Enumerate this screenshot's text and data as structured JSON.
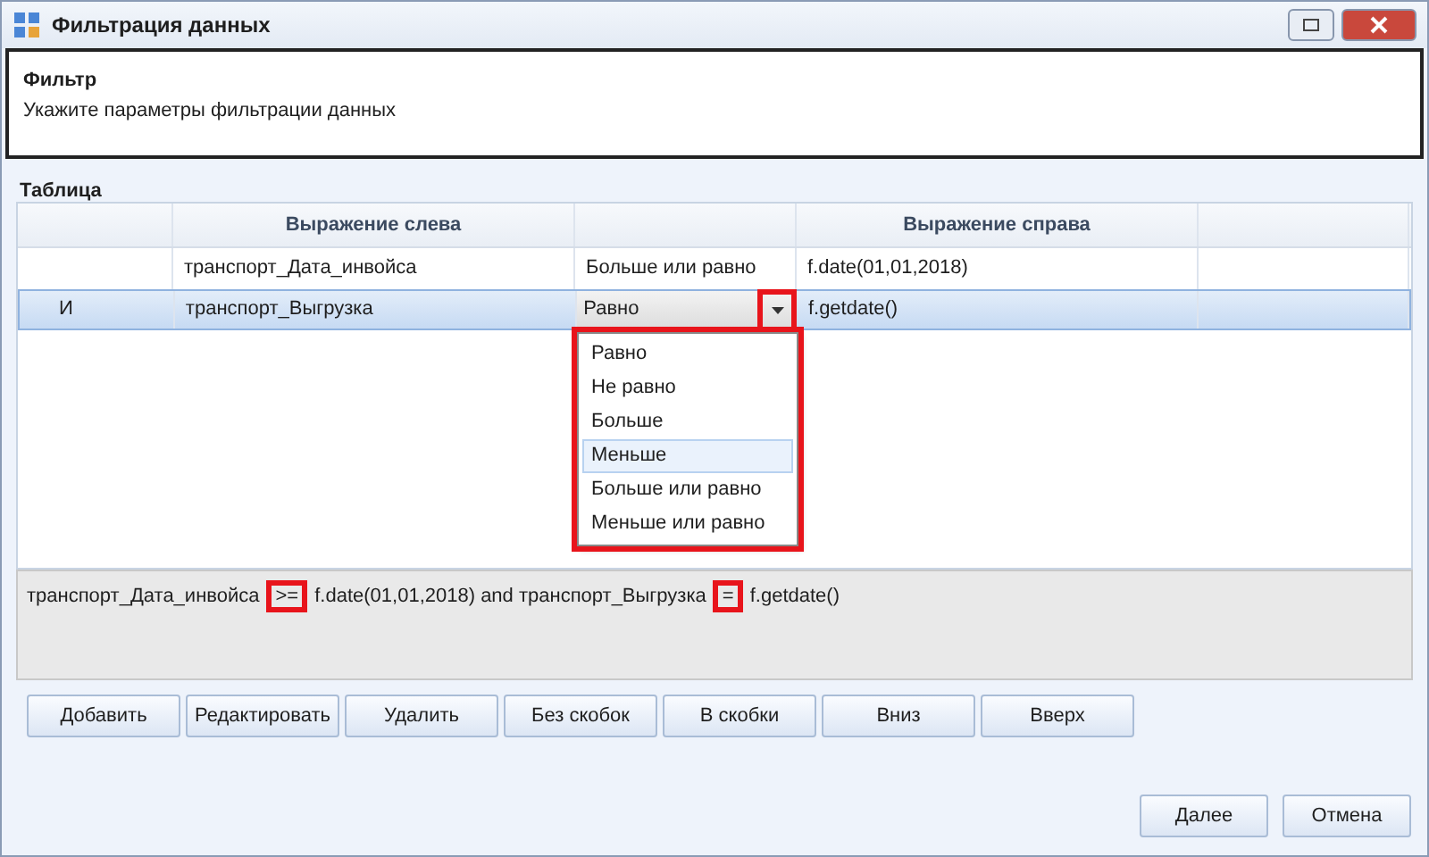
{
  "window": {
    "title": "Фильтрация данных"
  },
  "header": {
    "title": "Фильтр",
    "subtitle": "Укажите параметры фильтрации данных"
  },
  "table": {
    "label": "Таблица",
    "columns": [
      "",
      "Выражение слева",
      "",
      "Выражение справа",
      ""
    ],
    "rows": [
      {
        "selected": false,
        "editing": false,
        "cells": [
          "",
          "транспорт_Дата_инвойса",
          "Больше или равно",
          "f.date(01,01,2018)",
          ""
        ]
      },
      {
        "selected": true,
        "editing": true,
        "cells": [
          "И",
          "транспорт_Выгрузка",
          "Равно",
          "f.getdate()",
          ""
        ]
      }
    ]
  },
  "dropdown": {
    "annotated": true,
    "options": [
      {
        "label": "Равно",
        "selected": false
      },
      {
        "label": "Не равно",
        "selected": false
      },
      {
        "label": "Больше",
        "selected": false
      },
      {
        "label": "Меньше",
        "selected": true
      },
      {
        "label": "Больше или равно",
        "selected": false
      },
      {
        "label": "Меньше или равно",
        "selected": false
      }
    ]
  },
  "expression": [
    {
      "text": "транспорт_Дата_инвойса",
      "annotated": false
    },
    {
      "text": ">=",
      "annotated": true
    },
    {
      "text": "f.date(01,01,2018) and транспорт_Выгрузка",
      "annotated": false
    },
    {
      "text": "=",
      "annotated": true
    },
    {
      "text": "f.getdate()",
      "annotated": false
    }
  ],
  "toolbar_buttons": [
    "Добавить",
    "Редактировать",
    "Удалить",
    "Без скобок",
    "В скобки",
    "Вниз",
    "Вверх"
  ],
  "dialog_buttons": [
    "Далее",
    "Отмена"
  ]
}
